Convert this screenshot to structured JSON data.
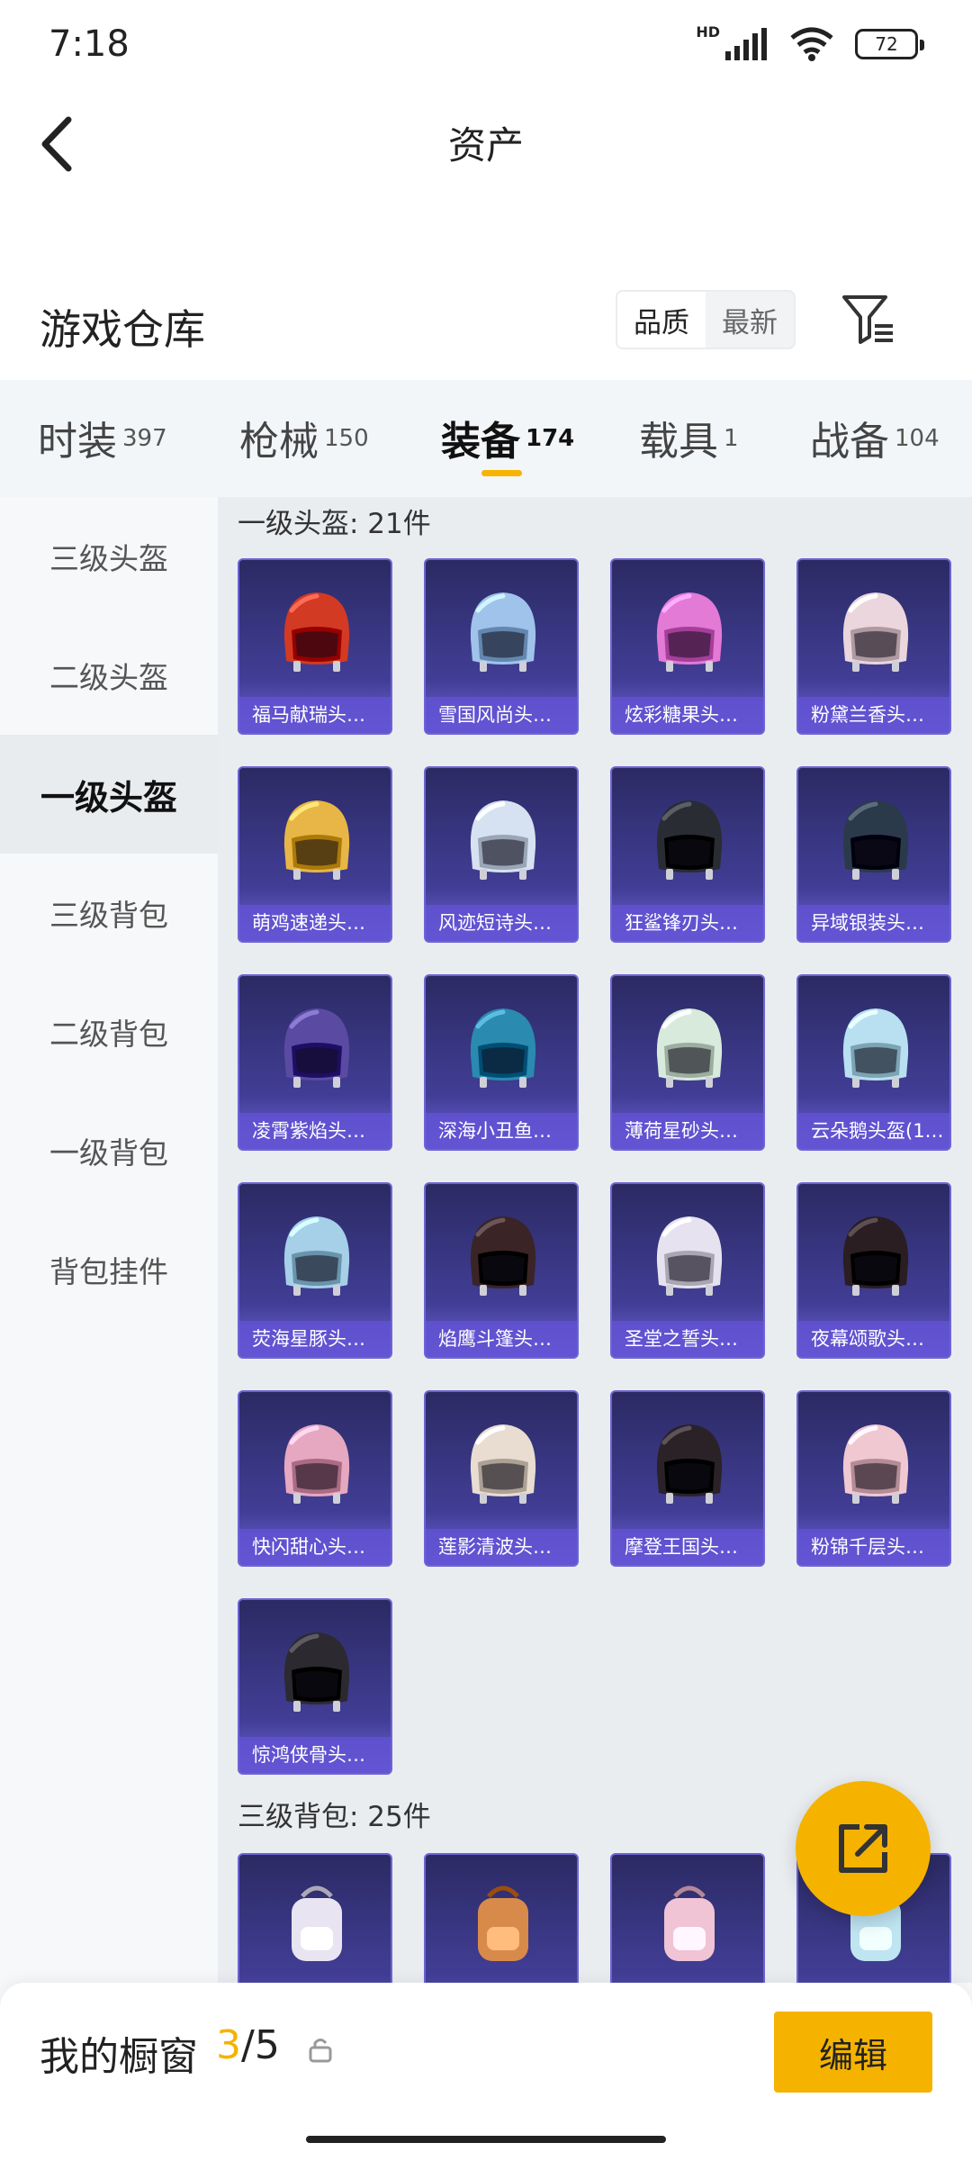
{
  "status": {
    "time": "7:18",
    "hd": "HD",
    "battery": "72"
  },
  "header": {
    "title": "资产"
  },
  "toolbar": {
    "title": "游戏仓库",
    "sort_options": [
      "品质",
      "最新"
    ]
  },
  "tabs": [
    {
      "label": "时装",
      "count": "397"
    },
    {
      "label": "枪械",
      "count": "150"
    },
    {
      "label": "装备",
      "count": "174"
    },
    {
      "label": "载具",
      "count": "1"
    },
    {
      "label": "战备",
      "count": "104"
    }
  ],
  "sidebar": {
    "items": [
      "三级头盔",
      "二级头盔",
      "一级头盔",
      "三级背包",
      "二级背包",
      "一级背包",
      "背包挂件"
    ],
    "active_index": 2
  },
  "sections": [
    {
      "title": "一级头盔: 21件",
      "items": [
        {
          "name": "福马献瑞头…",
          "color": "#d23a24",
          "icon": "helmet-icon"
        },
        {
          "name": "雪国风尚头…",
          "color": "#9fc3ea",
          "icon": "helmet-icon"
        },
        {
          "name": "炫彩糖果头…",
          "color": "#e27ad6",
          "icon": "helmet-icon"
        },
        {
          "name": "粉黛兰香头…",
          "color": "#ead6dc",
          "icon": "helmet-icon"
        },
        {
          "name": "萌鸡速递头…",
          "color": "#e8b646",
          "icon": "helmet-icon"
        },
        {
          "name": "风迹短诗头…",
          "color": "#d6e2f2",
          "icon": "helmet-icon"
        },
        {
          "name": "狂鲨锋刃头…",
          "color": "#2a2c34",
          "icon": "helmet-icon"
        },
        {
          "name": "异域银装头…",
          "color": "#2b3a4a",
          "icon": "helmet-icon"
        },
        {
          "name": "凌霄紫焰头…",
          "color": "#5b4aa2",
          "icon": "helmet-icon"
        },
        {
          "name": "深海小丑鱼…",
          "color": "#2a8ab0",
          "icon": "helmet-icon"
        },
        {
          "name": "薄荷星砂头…",
          "color": "#d8eadc",
          "icon": "helmet-icon"
        },
        {
          "name": "云朵鹅头盔(1…",
          "color": "#b8e0f0",
          "icon": "helmet-icon"
        },
        {
          "name": "荧海星豚头…",
          "color": "#a6cfe8",
          "icon": "helmet-icon"
        },
        {
          "name": "焰鹰斗篷头…",
          "color": "#3a2426",
          "icon": "helmet-icon"
        },
        {
          "name": "圣堂之誓头…",
          "color": "#e6e2f0",
          "icon": "helmet-icon"
        },
        {
          "name": "夜幕颂歌头…",
          "color": "#2a1e22",
          "icon": "helmet-icon"
        },
        {
          "name": "快闪甜心头…",
          "color": "#e6a8c0",
          "icon": "helmet-icon"
        },
        {
          "name": "莲影清波头…",
          "color": "#e8ddd0",
          "icon": "helmet-icon"
        },
        {
          "name": "摩登王国头…",
          "color": "#2a2226",
          "icon": "helmet-icon"
        },
        {
          "name": "粉锦千层头…",
          "color": "#f0c8d2",
          "icon": "helmet-icon"
        },
        {
          "name": "惊鸿侠骨头…",
          "color": "#2c2a30",
          "icon": "helmet-icon"
        }
      ]
    },
    {
      "title": "三级背包: 25件",
      "items": [
        {
          "name": "",
          "color": "#e8e4f2",
          "icon": "backpack-icon"
        },
        {
          "name": "",
          "color": "#d88a4a",
          "icon": "backpack-icon"
        },
        {
          "name": "",
          "color": "#f0c4d4",
          "icon": "backpack-icon"
        },
        {
          "name": "",
          "color": "#bfe4f2",
          "icon": "backpack-icon"
        }
      ]
    }
  ],
  "bottom": {
    "label": "我的橱窗",
    "current": "3",
    "total": "/5",
    "edit_label": "编辑"
  },
  "colors": {
    "accent": "#f5b300",
    "card_bg": "#3d3a8c",
    "card_label": "#6252d2"
  }
}
